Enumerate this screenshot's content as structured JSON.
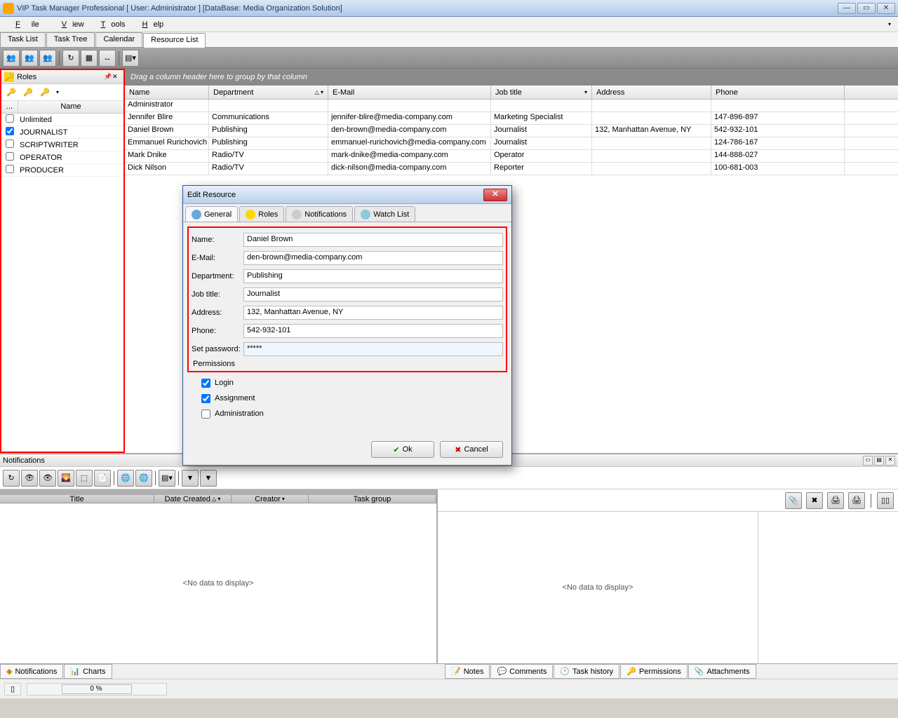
{
  "window_title": "VIP Task Manager Professional  [ User: Administrator ]  [DataBase: Media Organization Solution]",
  "menus": {
    "file": "File",
    "view": "View",
    "tools": "Tools",
    "help": "Help"
  },
  "tabs": {
    "task_list": "Task List",
    "task_tree": "Task Tree",
    "calendar": "Calendar",
    "resource_list": "Resource List"
  },
  "roles_panel": {
    "title": "Roles",
    "header_dots": "...",
    "header_name": "Name",
    "items": [
      {
        "checked": false,
        "name": "Unlimited"
      },
      {
        "checked": true,
        "name": "JOURNALIST"
      },
      {
        "checked": false,
        "name": "SCRIPTWRITER"
      },
      {
        "checked": false,
        "name": "OPERATOR"
      },
      {
        "checked": false,
        "name": "PRODUCER"
      }
    ]
  },
  "group_hint": "Drag a column header here to group by that column",
  "grid_headers": {
    "name": "Name",
    "dept": "Department",
    "email": "E-Mail",
    "job": "Job title",
    "addr": "Address",
    "phone": "Phone"
  },
  "resources": [
    {
      "name": "Administrator",
      "dept": "",
      "email": "",
      "job": "",
      "addr": "",
      "phone": ""
    },
    {
      "name": "Jennifer Blire",
      "dept": "Communications",
      "email": "jennifer-blire@media-company.com",
      "job": "Marketing Specialist",
      "addr": "",
      "phone": "147-896-897"
    },
    {
      "name": "Daniel Brown",
      "dept": "Publishing",
      "email": "den-brown@media-company.com",
      "job": "Journalist",
      "addr": "132, Manhattan Avenue, NY",
      "phone": "542-932-101"
    },
    {
      "name": "Emmanuel Rurichovich",
      "dept": "Publishing",
      "email": "emmanuel-rurichovich@media-company.com",
      "job": "Journalist",
      "addr": "",
      "phone": "124-786-167"
    },
    {
      "name": "Mark Dnike",
      "dept": "Radio/TV",
      "email": "mark-dnike@media-company.com",
      "job": "Operator",
      "addr": "",
      "phone": "144-888-027"
    },
    {
      "name": "Dick Nilson",
      "dept": "Radio/TV",
      "email": "dick-nilson@media-company.com",
      "job": "Reporter",
      "addr": "",
      "phone": "100-681-003"
    }
  ],
  "dialog": {
    "title": "Edit Resource",
    "tabs": {
      "general": "General",
      "roles": "Roles",
      "notifications": "Notifications",
      "watch": "Watch List"
    },
    "labels": {
      "name": "Name:",
      "email": "E-Mail:",
      "dept": "Department:",
      "job": "Job title:",
      "addr": "Address:",
      "phone": "Phone:",
      "pwd": "Set password:",
      "perm": "Permissions"
    },
    "values": {
      "name": "Daniel Brown",
      "email": "den-brown@media-company.com",
      "dept": "Publishing",
      "job": "Journalist",
      "addr": "132, Manhattan Avenue, NY",
      "phone": "542-932-101",
      "pwd": "*****"
    },
    "perms": {
      "login": "Login",
      "assign": "Assignment",
      "admin": "Administration"
    },
    "perm_values": {
      "login": true,
      "assign": true,
      "admin": false
    },
    "buttons": {
      "ok": "Ok",
      "cancel": "Cancel"
    }
  },
  "notifications": {
    "title": "Notifications",
    "headers": {
      "title": "Title",
      "date": "Date Created",
      "creator": "Creator",
      "group": "Task group"
    },
    "nodata": "<No data to display>"
  },
  "bottom_tabs_left": {
    "notif": "Notifications",
    "charts": "Charts"
  },
  "bottom_tabs_right": {
    "notes": "Notes",
    "comments": "Comments",
    "history": "Task history",
    "perms": "Permissions",
    "attach": "Attachments"
  },
  "status": {
    "progress": "0 %"
  }
}
